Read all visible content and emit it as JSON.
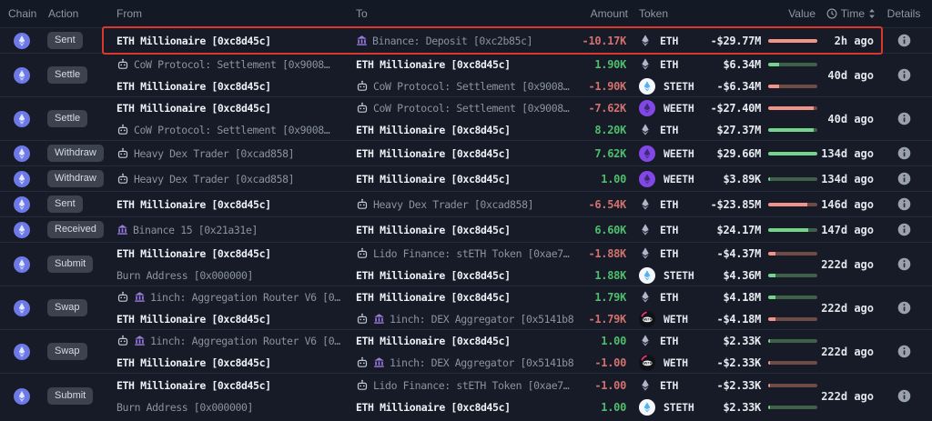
{
  "table": {
    "headers": {
      "chain": "Chain",
      "action": "Action",
      "from": "From",
      "to": "To",
      "amount": "Amount",
      "token": "Token",
      "value": "Value",
      "time": "Time",
      "details": "Details"
    },
    "chain_icon": "ethereum-icon",
    "rows": [
      {
        "action": "Sent",
        "time": "2h ago",
        "highlighted": true,
        "entries": [
          {
            "from": {
              "label": "ETH Millionaire [0xc8d45c]",
              "primary": true,
              "icons": []
            },
            "to": {
              "label": "Binance: Deposit [0xc2b85c]",
              "primary": false,
              "icons": [
                "bank-icon"
              ]
            },
            "amount": "-10.17K",
            "direction": "neg",
            "token": {
              "symbol": "ETH",
              "icon": "eth-token-icon"
            },
            "value": "-$29.77M",
            "bar_fraction": 1.0
          }
        ]
      },
      {
        "action": "Settle",
        "time": "40d ago",
        "entries": [
          {
            "from": {
              "label": "CoW Protocol: Settlement [0x9008…",
              "primary": false,
              "icons": [
                "robot-icon"
              ]
            },
            "to": {
              "label": "ETH Millionaire [0xc8d45c]",
              "primary": true,
              "icons": []
            },
            "amount": "1.90K",
            "direction": "pos",
            "token": {
              "symbol": "ETH",
              "icon": "eth-token-icon"
            },
            "value": "$6.34M",
            "bar_fraction": 0.22
          },
          {
            "from": {
              "label": "ETH Millionaire [0xc8d45c]",
              "primary": true,
              "icons": []
            },
            "to": {
              "label": "CoW Protocol: Settlement [0x9008…",
              "primary": false,
              "icons": [
                "robot-icon"
              ]
            },
            "amount": "-1.90K",
            "direction": "neg",
            "token": {
              "symbol": "STETH",
              "icon": "steth-token-icon"
            },
            "value": "-$6.34M",
            "bar_fraction": 0.22
          }
        ]
      },
      {
        "action": "Settle",
        "time": "40d ago",
        "entries": [
          {
            "from": {
              "label": "ETH Millionaire [0xc8d45c]",
              "primary": true,
              "icons": []
            },
            "to": {
              "label": "CoW Protocol: Settlement [0x9008…",
              "primary": false,
              "icons": [
                "robot-icon"
              ]
            },
            "amount": "-7.62K",
            "direction": "neg",
            "token": {
              "symbol": "WEETH",
              "icon": "weeth-token-icon"
            },
            "value": "-$27.40M",
            "bar_fraction": 0.92
          },
          {
            "from": {
              "label": "CoW Protocol: Settlement [0x9008…",
              "primary": false,
              "icons": [
                "robot-icon"
              ]
            },
            "to": {
              "label": "ETH Millionaire [0xc8d45c]",
              "primary": true,
              "icons": []
            },
            "amount": "8.20K",
            "direction": "pos",
            "token": {
              "symbol": "ETH",
              "icon": "eth-token-icon"
            },
            "value": "$27.37M",
            "bar_fraction": 0.92
          }
        ]
      },
      {
        "action": "Withdraw",
        "time": "134d ago",
        "entries": [
          {
            "from": {
              "label": "Heavy Dex Trader [0xcad858]",
              "primary": false,
              "icons": [
                "robot-icon"
              ]
            },
            "to": {
              "label": "ETH Millionaire [0xc8d45c]",
              "primary": true,
              "icons": []
            },
            "amount": "7.62K",
            "direction": "pos",
            "token": {
              "symbol": "WEETH",
              "icon": "weeth-token-icon"
            },
            "value": "$29.66M",
            "bar_fraction": 1.0
          }
        ]
      },
      {
        "action": "Withdraw",
        "time": "134d ago",
        "entries": [
          {
            "from": {
              "label": "Heavy Dex Trader [0xcad858]",
              "primary": false,
              "icons": [
                "robot-icon"
              ]
            },
            "to": {
              "label": "ETH Millionaire [0xc8d45c]",
              "primary": true,
              "icons": []
            },
            "amount": "1.00",
            "direction": "pos",
            "token": {
              "symbol": "WEETH",
              "icon": "weeth-token-icon"
            },
            "value": "$3.89K",
            "bar_fraction": 0.03
          }
        ]
      },
      {
        "action": "Sent",
        "time": "146d ago",
        "entries": [
          {
            "from": {
              "label": "ETH Millionaire [0xc8d45c]",
              "primary": true,
              "icons": []
            },
            "to": {
              "label": "Heavy Dex Trader [0xcad858]",
              "primary": false,
              "icons": [
                "robot-icon"
              ]
            },
            "amount": "-6.54K",
            "direction": "neg",
            "token": {
              "symbol": "ETH",
              "icon": "eth-token-icon"
            },
            "value": "-$23.85M",
            "bar_fraction": 0.8
          }
        ]
      },
      {
        "action": "Received",
        "time": "147d ago",
        "entries": [
          {
            "from": {
              "label": "Binance 15 [0x21a31e]",
              "primary": false,
              "icons": [
                "bank-icon"
              ]
            },
            "to": {
              "label": "ETH Millionaire [0xc8d45c]",
              "primary": true,
              "icons": []
            },
            "amount": "6.60K",
            "direction": "pos",
            "token": {
              "symbol": "ETH",
              "icon": "eth-token-icon"
            },
            "value": "$24.17M",
            "bar_fraction": 0.81
          }
        ]
      },
      {
        "action": "Submit",
        "time": "222d ago",
        "entries": [
          {
            "from": {
              "label": "ETH Millionaire [0xc8d45c]",
              "primary": true,
              "icons": []
            },
            "to": {
              "label": "Lido Finance: stETH Token [0xae7…",
              "primary": false,
              "icons": [
                "robot-icon"
              ]
            },
            "amount": "-1.88K",
            "direction": "neg",
            "token": {
              "symbol": "ETH",
              "icon": "eth-token-icon"
            },
            "value": "-$4.37M",
            "bar_fraction": 0.15
          },
          {
            "from": {
              "label": "Burn Address [0x000000]",
              "primary": false,
              "icons": []
            },
            "to": {
              "label": "ETH Millionaire [0xc8d45c]",
              "primary": true,
              "icons": []
            },
            "amount": "1.88K",
            "direction": "pos",
            "token": {
              "symbol": "STETH",
              "icon": "steth-token-icon"
            },
            "value": "$4.36M",
            "bar_fraction": 0.15
          }
        ]
      },
      {
        "action": "Swap",
        "time": "222d ago",
        "entries": [
          {
            "from": {
              "label": "1inch: Aggregation Router V6 [0…",
              "primary": false,
              "icons": [
                "robot-icon",
                "bank-icon"
              ]
            },
            "to": {
              "label": "ETH Millionaire [0xc8d45c]",
              "primary": true,
              "icons": []
            },
            "amount": "1.79K",
            "direction": "pos",
            "token": {
              "symbol": "ETH",
              "icon": "eth-token-icon"
            },
            "value": "$4.18M",
            "bar_fraction": 0.14
          },
          {
            "from": {
              "label": "ETH Millionaire [0xc8d45c]",
              "primary": true,
              "icons": []
            },
            "to": {
              "label": "1inch: DEX Aggregator [0x5141b8]",
              "primary": false,
              "icons": [
                "robot-icon",
                "bank-icon"
              ]
            },
            "amount": "-1.79K",
            "direction": "neg",
            "token": {
              "symbol": "WETH",
              "icon": "weth-token-icon"
            },
            "value": "-$4.18M",
            "bar_fraction": 0.14
          }
        ]
      },
      {
        "action": "Swap",
        "time": "222d ago",
        "entries": [
          {
            "from": {
              "label": "1inch: Aggregation Router V6 [0…",
              "primary": false,
              "icons": [
                "robot-icon",
                "bank-icon"
              ]
            },
            "to": {
              "label": "ETH Millionaire [0xc8d45c]",
              "primary": true,
              "icons": []
            },
            "amount": "1.00",
            "direction": "pos",
            "token": {
              "symbol": "ETH",
              "icon": "eth-token-icon"
            },
            "value": "$2.33K",
            "bar_fraction": 0.03
          },
          {
            "from": {
              "label": "ETH Millionaire [0xc8d45c]",
              "primary": true,
              "icons": []
            },
            "to": {
              "label": "1inch: DEX Aggregator [0x5141b8]",
              "primary": false,
              "icons": [
                "robot-icon",
                "bank-icon"
              ]
            },
            "amount": "-1.00",
            "direction": "neg",
            "token": {
              "symbol": "WETH",
              "icon": "weth-token-icon"
            },
            "value": "-$2.33K",
            "bar_fraction": 0.03
          }
        ]
      },
      {
        "action": "Submit",
        "time": "222d ago",
        "entries": [
          {
            "from": {
              "label": "ETH Millionaire [0xc8d45c]",
              "primary": true,
              "icons": []
            },
            "to": {
              "label": "Lido Finance: stETH Token [0xae7…",
              "primary": false,
              "icons": [
                "robot-icon"
              ]
            },
            "amount": "-1.00",
            "direction": "neg",
            "token": {
              "symbol": "ETH",
              "icon": "eth-token-icon"
            },
            "value": "-$2.33K",
            "bar_fraction": 0.03
          },
          {
            "from": {
              "label": "Burn Address [0x000000]",
              "primary": false,
              "icons": []
            },
            "to": {
              "label": "ETH Millionaire [0xc8d45c]",
              "primary": true,
              "icons": []
            },
            "amount": "1.00",
            "direction": "pos",
            "token": {
              "symbol": "STETH",
              "icon": "steth-token-icon"
            },
            "value": "$2.33K",
            "bar_fraction": 0.03
          }
        ]
      }
    ]
  },
  "colors": {
    "bg": "#161b27",
    "header_bg": "#141926",
    "header_text": "#8f97a4",
    "separator": "#242b3a",
    "entity_primary": "#edf0f4",
    "entity_secondary": "#8a93a1",
    "badge_bg": "#3c434f",
    "badge_text": "#d6dbe2",
    "positive": "#4fbe6c",
    "negative": "#d2716e",
    "bar_pos_bright": "#74d48c",
    "bar_pos_dim": "#3f6049",
    "bar_neg_bright": "#ef9486",
    "bar_neg_dim": "#6f4b46",
    "bank_purple": "#9b7be0",
    "chain_badge": "#6d79e6",
    "accent_red_box": "#db372d"
  }
}
